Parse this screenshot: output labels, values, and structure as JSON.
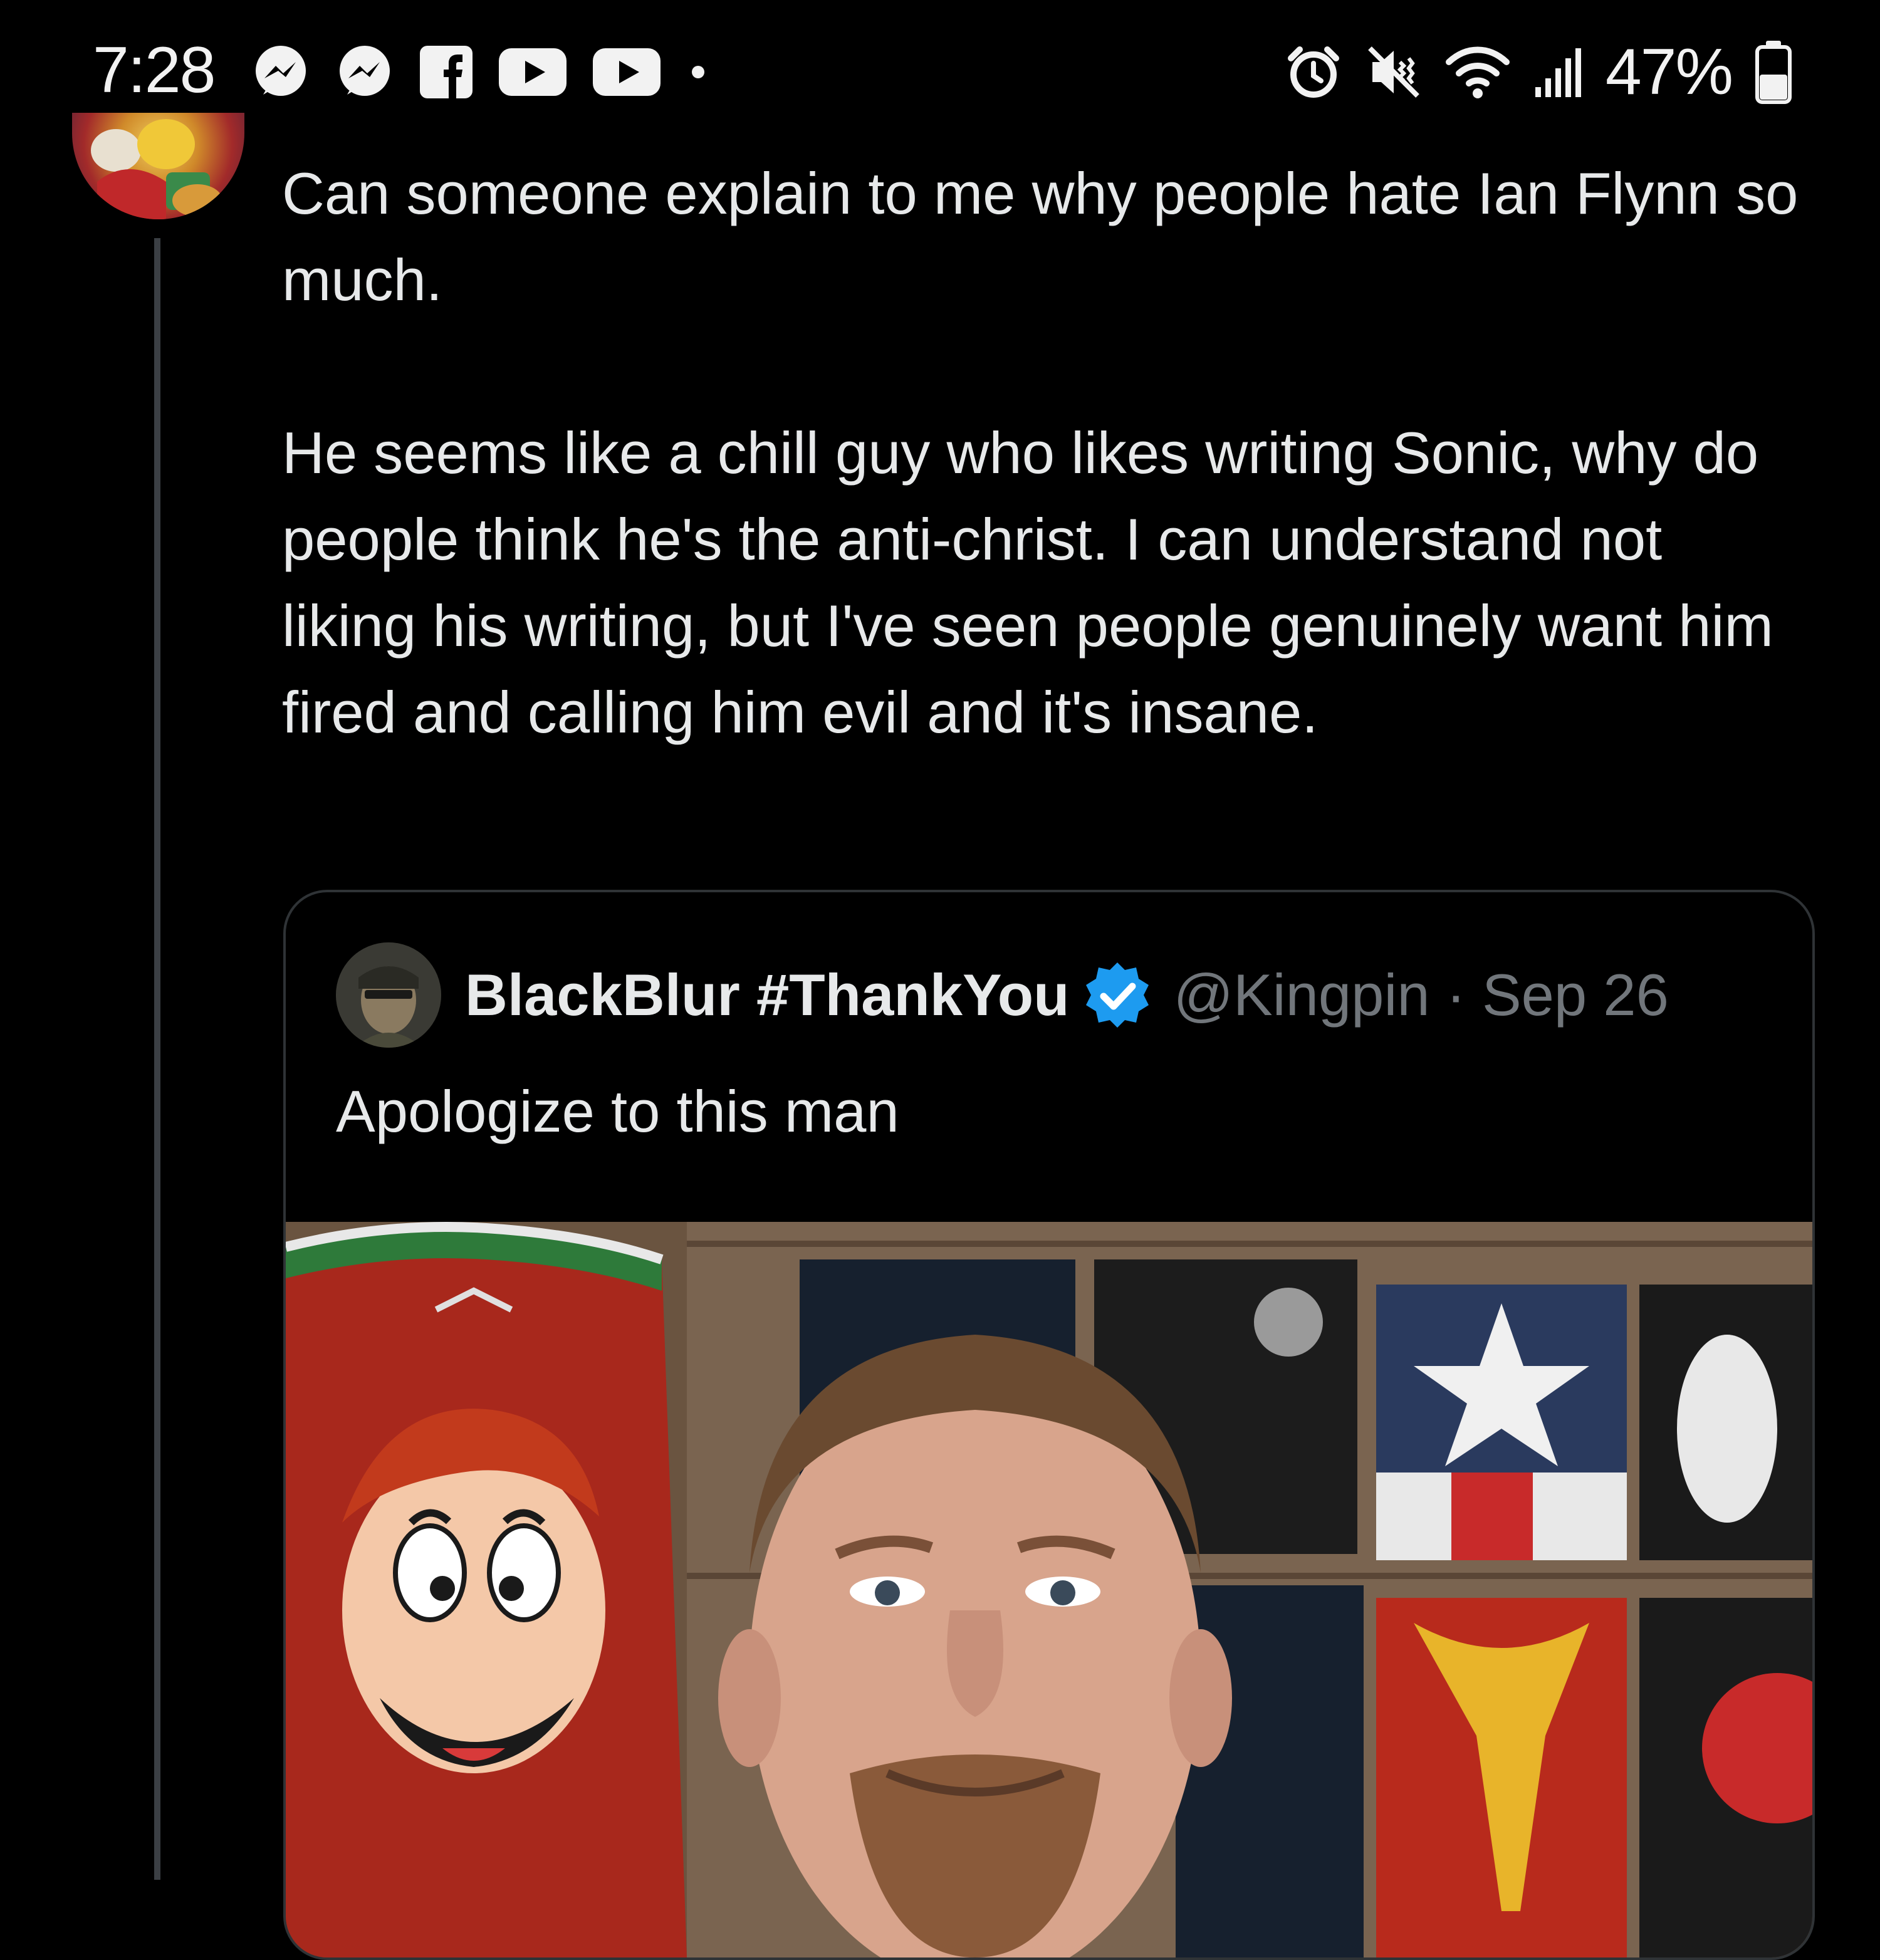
{
  "status_bar": {
    "time": "7:28",
    "notification_icons": [
      "messenger-icon",
      "messenger-icon",
      "facebook-icon",
      "youtube-icon",
      "youtube-icon",
      "dot-icon"
    ],
    "system_icons": [
      "alarm-icon",
      "vibrate-mute-icon",
      "wifi-icon",
      "signal-icon"
    ],
    "battery_percent": "47%"
  },
  "tweet": {
    "paragraphs": [
      "Can someone explain to me why people hate Ian Flynn so much.",
      "He seems like a chill guy who likes writing Sonic, why do people think he's the anti-christ. I can understand not liking his writing, but I've seen people genuinely want him fired and calling him evil and it's insane."
    ]
  },
  "quote": {
    "display_name": "BlackBlur #ThankYou",
    "handle": "@Kingpin",
    "separator": "·",
    "date": "Sep 26",
    "text": "Apologize to this man",
    "verified": true
  },
  "colors": {
    "background": "#000000",
    "text_primary": "#e7e9ea",
    "text_secondary": "#71767b",
    "border": "#2f3336",
    "verified_blue": "#1d9bf0"
  }
}
